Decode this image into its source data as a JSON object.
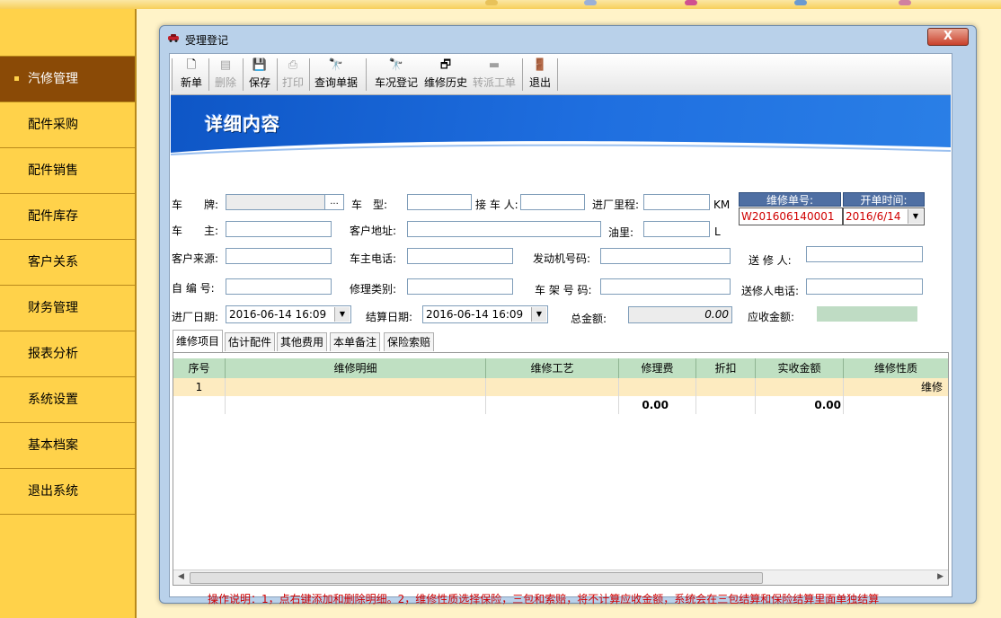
{
  "sidebar": {
    "items": [
      {
        "label": "汽修管理",
        "active": true
      },
      {
        "label": "配件采购"
      },
      {
        "label": "配件销售"
      },
      {
        "label": "配件库存"
      },
      {
        "label": "客户关系"
      },
      {
        "label": "财务管理"
      },
      {
        "label": "报表分析"
      },
      {
        "label": "系统设置"
      },
      {
        "label": "基本档案"
      },
      {
        "label": "退出系统"
      }
    ]
  },
  "window": {
    "title": "受理登记",
    "close_label": "X"
  },
  "toolbar": {
    "new_label": "新单",
    "delete_label": "删除",
    "save_label": "保存",
    "print_label": "打印",
    "query_label": "查询单据",
    "vehicle_check_label": "车况登记",
    "repair_history_label": "维修历史",
    "transfer_label": "转派工单",
    "exit_label": "退出"
  },
  "banner": {
    "title": "详细内容"
  },
  "form": {
    "plate_label": "车　　牌:",
    "browse_label": "...",
    "model_label": "车　型:",
    "receiver_label": "接 车 人:",
    "mileage_label": "进厂里程:",
    "mileage_unit": "KM",
    "owner_label": "车　　主:",
    "address_label": "客户地址:",
    "fuel_label": "油里:",
    "fuel_unit": "L",
    "source_label": "客户来源:",
    "owner_phone_label": "车主电话:",
    "engine_no_label": "发动机号码:",
    "sender_label": "送 修 人:",
    "self_no_label": "自 编 号:",
    "repair_type_label": "修理类别:",
    "frame_no_label": "车 架 号 码:",
    "sender_phone_label": "送修人电话:",
    "in_date_label": "进厂日期:",
    "in_date_value": "2016-06-14 16:09",
    "settle_date_label": "结算日期:",
    "settle_date_value": "2016-06-14 16:09",
    "total_label": "总金额:",
    "total_value": "0.00",
    "receivable_label": "应收金额:",
    "order_no_header": "维修单号:",
    "order_no_value": "W201606140001",
    "open_time_header": "开单时间:",
    "open_time_value": "2016/6/14"
  },
  "tabs": [
    "维修项目",
    "估计配件",
    "其他费用",
    "本单备注",
    "保险索赔"
  ],
  "grid": {
    "columns": [
      "序号",
      "维修明细",
      "维修工艺",
      "修理费",
      "折扣",
      "实收金额",
      "维修性质"
    ],
    "rows": [
      {
        "seq": "1",
        "detail": "",
        "craft": "",
        "fee": "",
        "discount": "",
        "actual": "",
        "nature": "维修"
      }
    ],
    "totals": {
      "fee": "0.00",
      "actual": "0.00"
    }
  },
  "note": "操作说明：1，点右键添加和删除明细。2，维修性质选择保险，三包和索赔，将不计算应收金额，系统会在三包结算和保险结算里面单独结算"
}
